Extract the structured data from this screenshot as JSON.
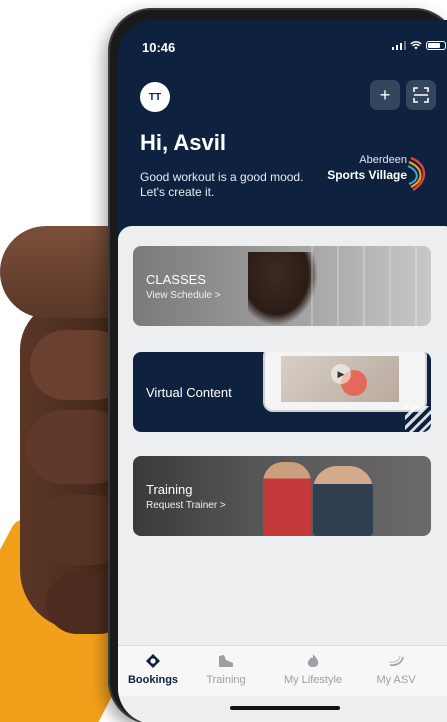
{
  "status_bar": {
    "time": "10:46"
  },
  "header": {
    "avatar_initials": "TT",
    "greeting": "Hi, Asvil",
    "tagline": "Good workout is a good mood. Let's create it.",
    "add_icon": "plus-icon",
    "scan_icon": "scan-icon"
  },
  "brand": {
    "line1": "Aberdeen",
    "line2": "Sports Village"
  },
  "cards": {
    "classes": {
      "title": "CLASSES",
      "subtitle": "View Schedule >"
    },
    "virtual": {
      "title": "Virtual Content"
    },
    "training": {
      "title": "Training",
      "subtitle": "Request Trainer >"
    }
  },
  "tabbar": {
    "items": [
      {
        "label": "Bookings",
        "icon": "bookings-icon",
        "active": true
      },
      {
        "label": "Training",
        "icon": "shoe-icon",
        "active": false
      },
      {
        "label": "My Lifestyle",
        "icon": "flame-icon",
        "active": false
      },
      {
        "label": "My ASV",
        "icon": "swoosh-icon",
        "active": false
      }
    ]
  },
  "colors": {
    "header_bg": "#0e2240",
    "accent_orange": "#f2a01c",
    "content_bg": "#eceef0"
  }
}
